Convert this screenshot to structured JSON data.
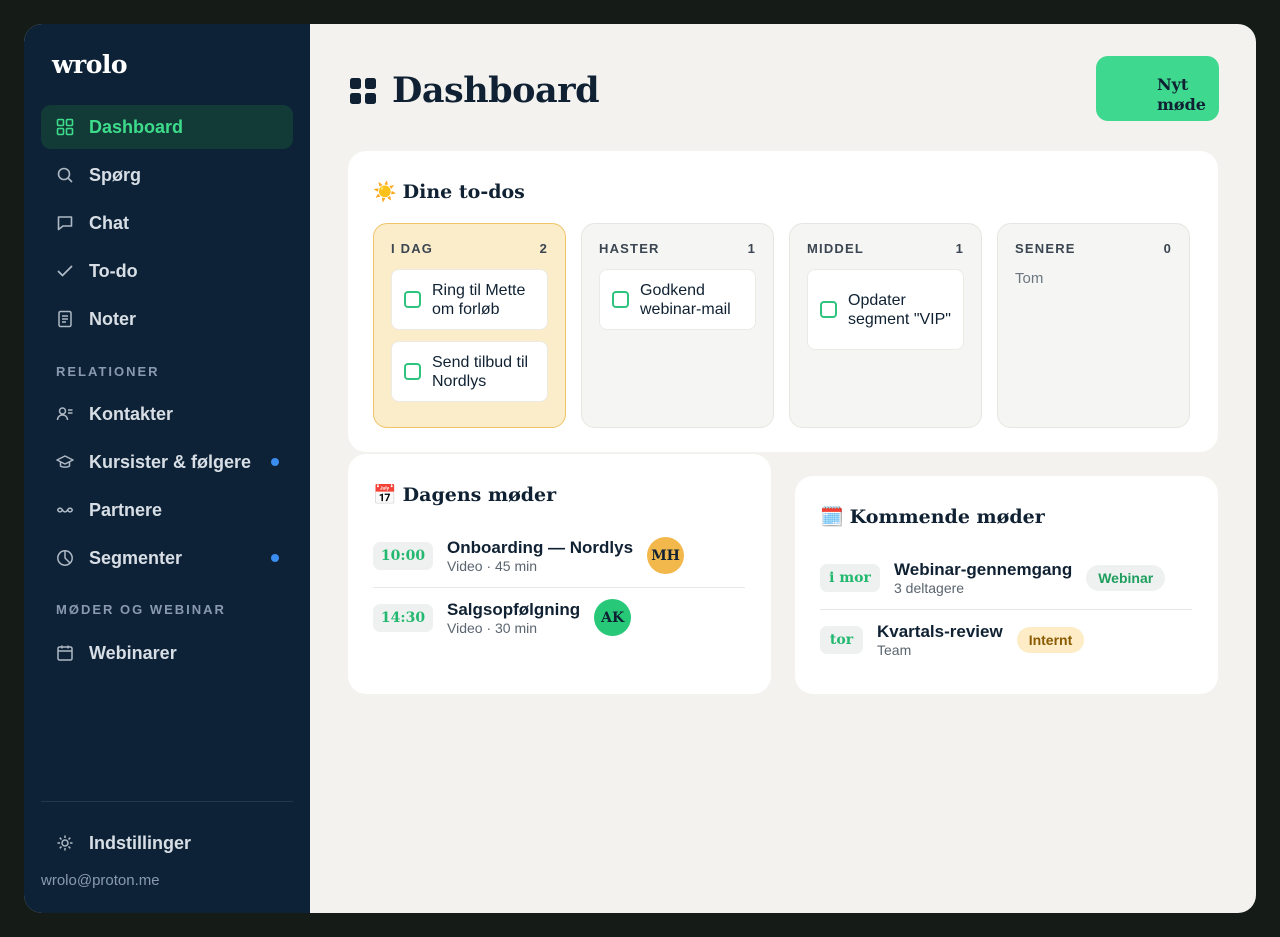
{
  "app": {
    "logo": "wrolo"
  },
  "sidebar": {
    "items": [
      {
        "label": "Dashboard",
        "icon": "grid-icon",
        "active": true
      },
      {
        "label": "Spørg",
        "icon": "search-icon"
      },
      {
        "label": "Chat",
        "icon": "chat-icon"
      },
      {
        "label": "To-do",
        "icon": "check-icon"
      },
      {
        "label": "Noter",
        "icon": "notes-icon"
      }
    ],
    "section_relations": "RELATIONER",
    "relations": [
      {
        "label": "Kontakter",
        "icon": "contacts-icon"
      },
      {
        "label": "Kursister & følgere",
        "icon": "graduation-cap-icon",
        "dot": true
      },
      {
        "label": "Partnere",
        "icon": "handshake-icon"
      },
      {
        "label": "Segmenter",
        "icon": "pie-chart-icon",
        "dot": true
      }
    ],
    "section_meetings": "MØDER OG WEBINAR",
    "meetings": [
      {
        "label": "Webinarer",
        "icon": "calendar-icon"
      }
    ],
    "settings": {
      "label": "Indstillinger",
      "icon": "gear-icon"
    },
    "email": "wrolo@proton.me",
    "dot_color": "#3b8ef0"
  },
  "header": {
    "title": "Dashboard",
    "new_button": "Nyt møde",
    "accent": "#3ed88f"
  },
  "todos": {
    "title": "Dine to-dos",
    "emoji": "☀️",
    "columns": [
      {
        "label": "I DAG",
        "count": "2",
        "items": [
          "Ring til Mette om forløb",
          "Send tilbud til Nordlys"
        ]
      },
      {
        "label": "HASTER",
        "count": "1",
        "items": [
          "Godkend webinar-mail"
        ]
      },
      {
        "label": "MIDDEL",
        "count": "1",
        "items": [
          "Opdater segment \"VIP\""
        ]
      },
      {
        "label": "SENERE",
        "count": "0",
        "empty": "Tom"
      }
    ]
  },
  "today_meetings": {
    "title": "Dagens møder",
    "emoji": "📅",
    "rows": [
      {
        "time": "10:00",
        "name": "Onboarding — Nordlys",
        "sub": "Video · 45 min",
        "initials": "MH",
        "avatar_color": "#f2b84b"
      },
      {
        "time": "14:30",
        "name": "Salgsopfølgning",
        "sub": "Video · 30 min",
        "initials": "AK",
        "avatar_color": "#27c878"
      }
    ]
  },
  "upcoming_meetings": {
    "title": "Kommende møder",
    "emoji": "🗓️",
    "rows": [
      {
        "when": "i mor",
        "name": "Webinar-gennemgang",
        "sub": "3 deltagere",
        "tag": "Webinar",
        "tag_bg": "#eef1ef",
        "tag_color": "#1e9e5e"
      },
      {
        "when": "tor",
        "name": "Kvartals-review",
        "sub": "Team",
        "tag": "Internt",
        "tag_bg": "#fdecc6",
        "tag_color": "#8a5a00"
      }
    ]
  }
}
